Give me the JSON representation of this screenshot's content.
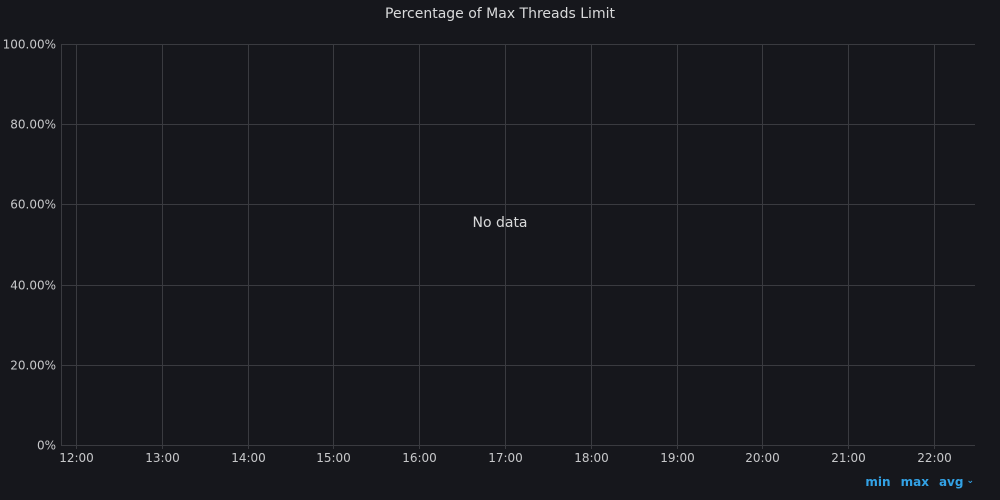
{
  "panel": {
    "title": "Percentage of Max Threads Limit",
    "no_data_text": "No data"
  },
  "legend": {
    "min_label": "min",
    "max_label": "max",
    "avg_label": "avg",
    "sort_icon": "chevron-down-icon"
  },
  "colors": {
    "background": "#16171c",
    "grid": "#3a3b40",
    "axis_text": "#c7c8ca",
    "legend_accent": "#33a2e5"
  },
  "chart_data": {
    "type": "line",
    "title": "Percentage of Max Threads Limit",
    "x_tick_labels": [
      "12:00",
      "13:00",
      "14:00",
      "15:00",
      "16:00",
      "17:00",
      "18:00",
      "19:00",
      "20:00",
      "21:00",
      "22:00"
    ],
    "y_tick_labels": [
      "0%",
      "20.00%",
      "40.00%",
      "60.00%",
      "80.00%",
      "100.00%"
    ],
    "y_ticks": [
      0,
      20,
      40,
      60,
      80,
      100
    ],
    "ylim": [
      0,
      100
    ],
    "series": [],
    "grid": true
  }
}
